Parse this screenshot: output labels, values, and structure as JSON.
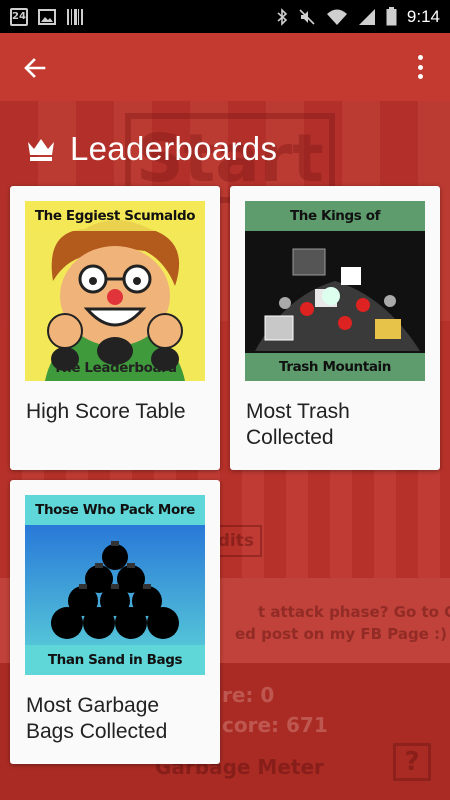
{
  "status_bar": {
    "calendar_day": "24",
    "time": "9:14",
    "icons": [
      "calendar-icon",
      "image-icon",
      "barcode-icon",
      "bluetooth-icon",
      "mute-icon",
      "wifi-icon",
      "signal-icon",
      "battery-icon"
    ]
  },
  "background": {
    "start_label": "Start",
    "credits_label": "dits",
    "notice_line1": "t attack phase? Go to Credits,",
    "notice_line2": "ed post on my FB Page :)",
    "score_label": "re: 0",
    "high_score_label": "core: 671",
    "meter_label": "Garbage Meter",
    "help_label": "?"
  },
  "app_bar": {
    "back_icon": "arrow-back-icon",
    "menu_icon": "more-vert-icon"
  },
  "page": {
    "title": "Leaderboards",
    "title_icon": "crown-icon"
  },
  "leaderboards": [
    {
      "image_top_text": "The Eggiest Scumaldo",
      "image_bottom_text": "The Leaderboard",
      "label": "High Score Table"
    },
    {
      "image_top_text": "The Kings of",
      "image_bottom_text": "Trash Mountain",
      "label": "Most Trash Collected"
    },
    {
      "image_top_text": "Those Who Pack More",
      "image_bottom_text": "Than Sand in Bags",
      "label": "Most Garbage Bags Collected"
    }
  ],
  "colors": {
    "primary": "#b9322b",
    "card": "#fafafa",
    "card_text": "#222222",
    "banner_yellow": "#f3e857",
    "banner_green": "#5e9c6e",
    "banner_teal": "#5fd6d8"
  }
}
